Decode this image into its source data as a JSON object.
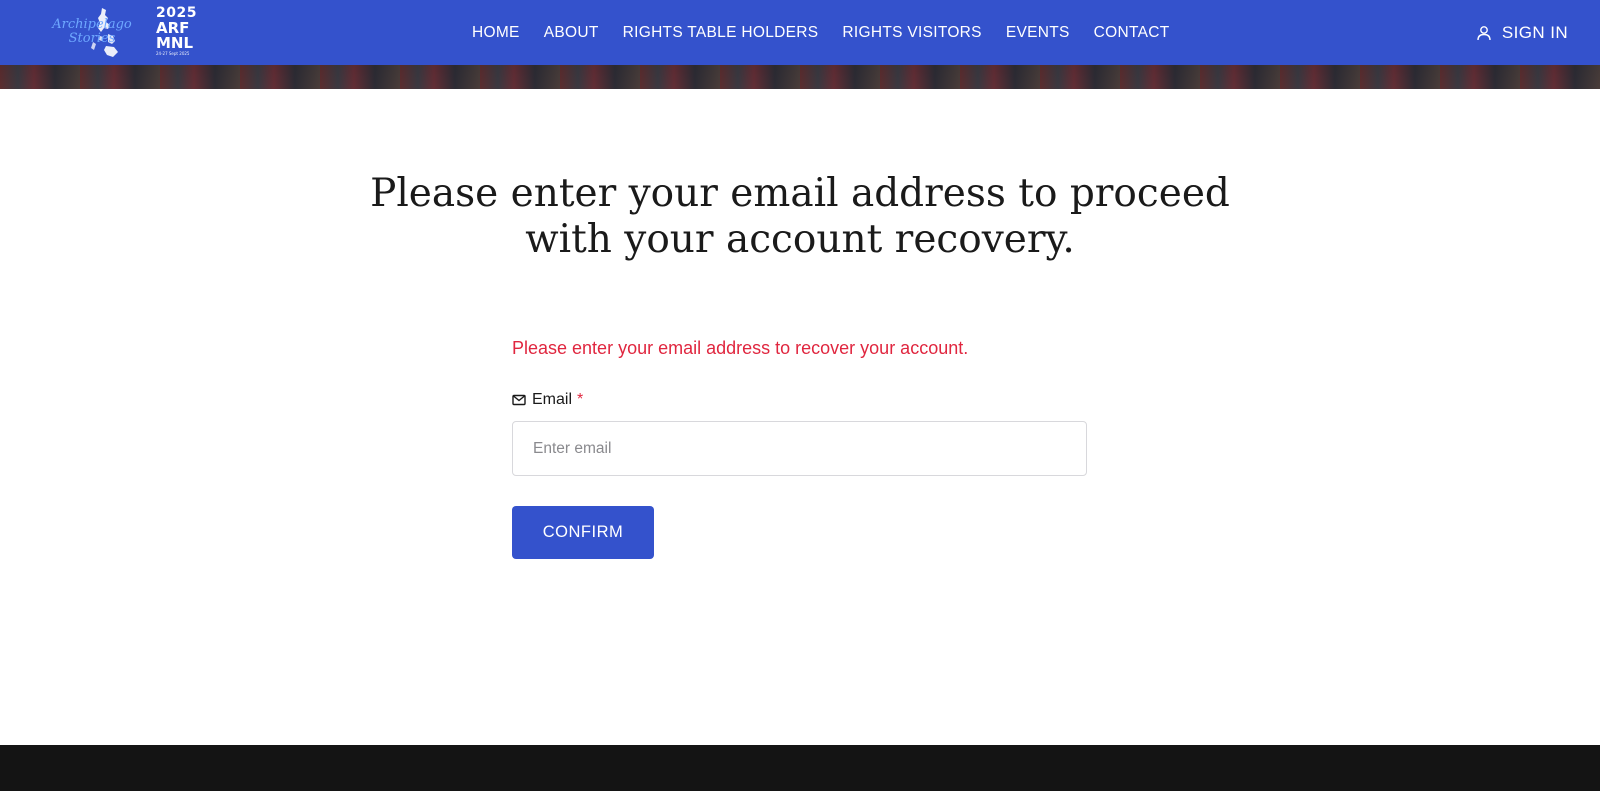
{
  "brand": {
    "logo_script": "Archipelago Stories",
    "logo_year": "2025",
    "logo_line1": "ARF",
    "logo_line2": "MNL",
    "logo_dates": "24-27 Sept 2025",
    "accent_color": "#3452cc"
  },
  "nav": {
    "items": [
      {
        "label": "HOME"
      },
      {
        "label": "ABOUT"
      },
      {
        "label": "RIGHTS TABLE HOLDERS"
      },
      {
        "label": "RIGHTS VISITORS"
      },
      {
        "label": "EVENTS"
      },
      {
        "label": "CONTACT"
      }
    ],
    "signin_label": "SIGN IN",
    "signin_icon": "user-icon"
  },
  "recovery": {
    "heading": "Please enter your email address to proceed with your account recovery.",
    "notice": "Please enter your email address to recover your account.",
    "notice_color": "#e0263f",
    "email_label": "Email",
    "email_icon": "envelope-icon",
    "required_mark": "*",
    "email_value": "",
    "email_placeholder": "Enter email",
    "confirm_label": "CONFIRM"
  }
}
